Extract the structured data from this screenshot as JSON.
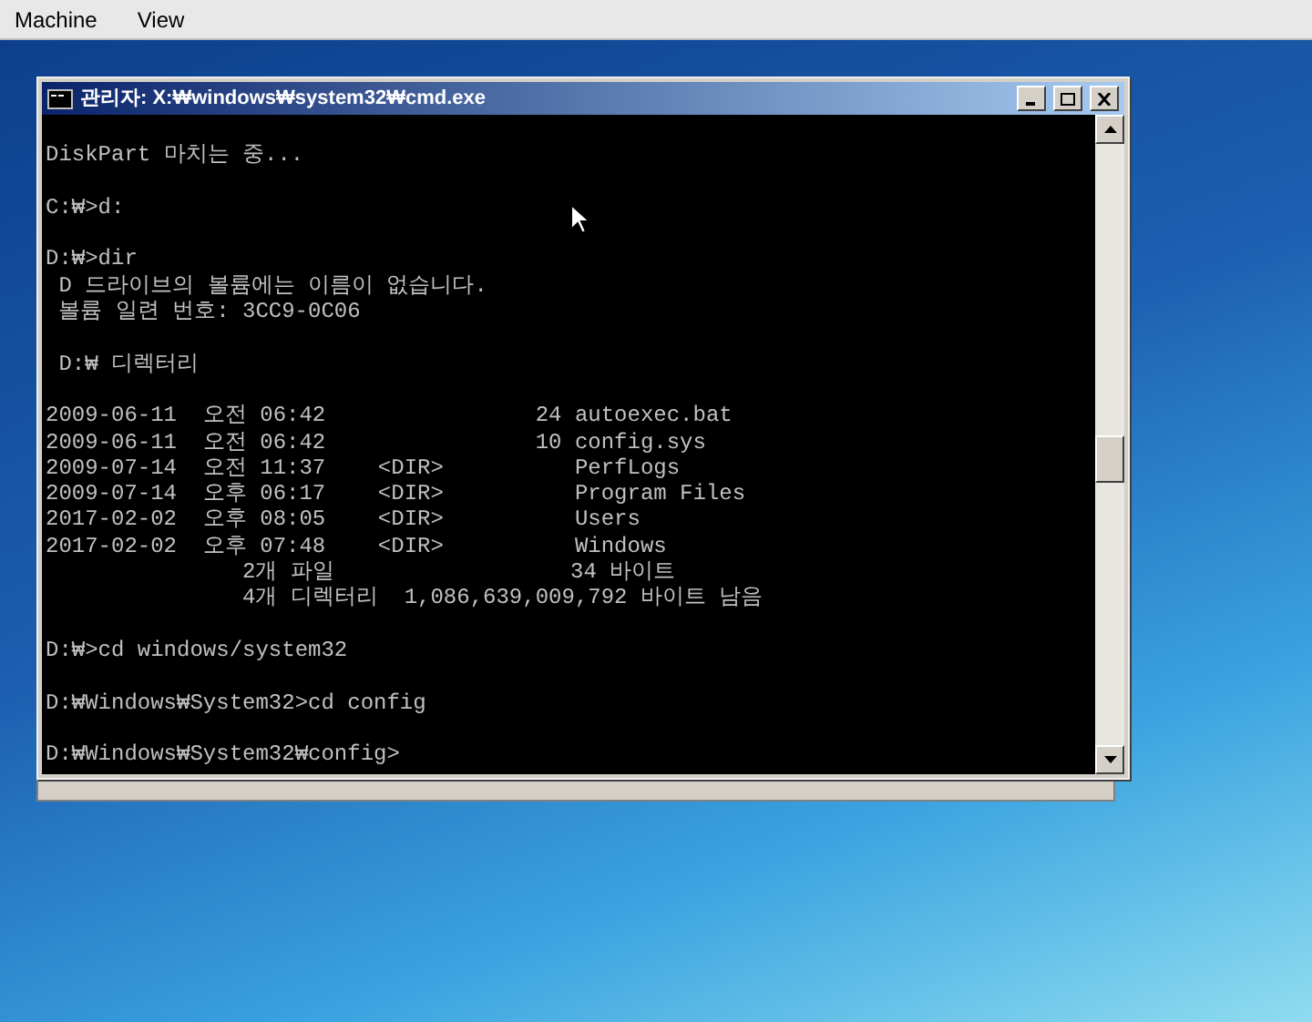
{
  "menu_bar": {
    "items": [
      "Machine",
      "View"
    ]
  },
  "window": {
    "title": "관리자: X:₩windows₩system32₩cmd.exe"
  },
  "console": {
    "blocks": [
      [
        "DiskPart 마치는 중..."
      ],
      [
        "C:₩>d:"
      ],
      [
        "D:₩>dir",
        " D 드라이브의 볼륨에는 이름이 없습니다.",
        " 볼륨 일련 번호: 3CC9-0C06"
      ],
      [
        " D:₩ 디렉터리"
      ],
      [
        "2009-06-11  오전 06:42                24 autoexec.bat",
        "2009-06-11  오전 06:42                10 config.sys",
        "2009-07-14  오전 11:37    <DIR>          PerfLogs",
        "2009-07-14  오후 06:17    <DIR>          Program Files",
        "2017-02-02  오후 08:05    <DIR>          Users",
        "2017-02-02  오후 07:48    <DIR>          Windows",
        "               2개 파일                  34 바이트",
        "               4개 디렉터리  1,086,639,009,792 바이트 남음"
      ],
      [
        "D:₩>cd windows/system32"
      ],
      [
        "D:₩Windows₩System32>cd config"
      ],
      [
        "D:₩Windows₩System32₩config>"
      ]
    ]
  }
}
